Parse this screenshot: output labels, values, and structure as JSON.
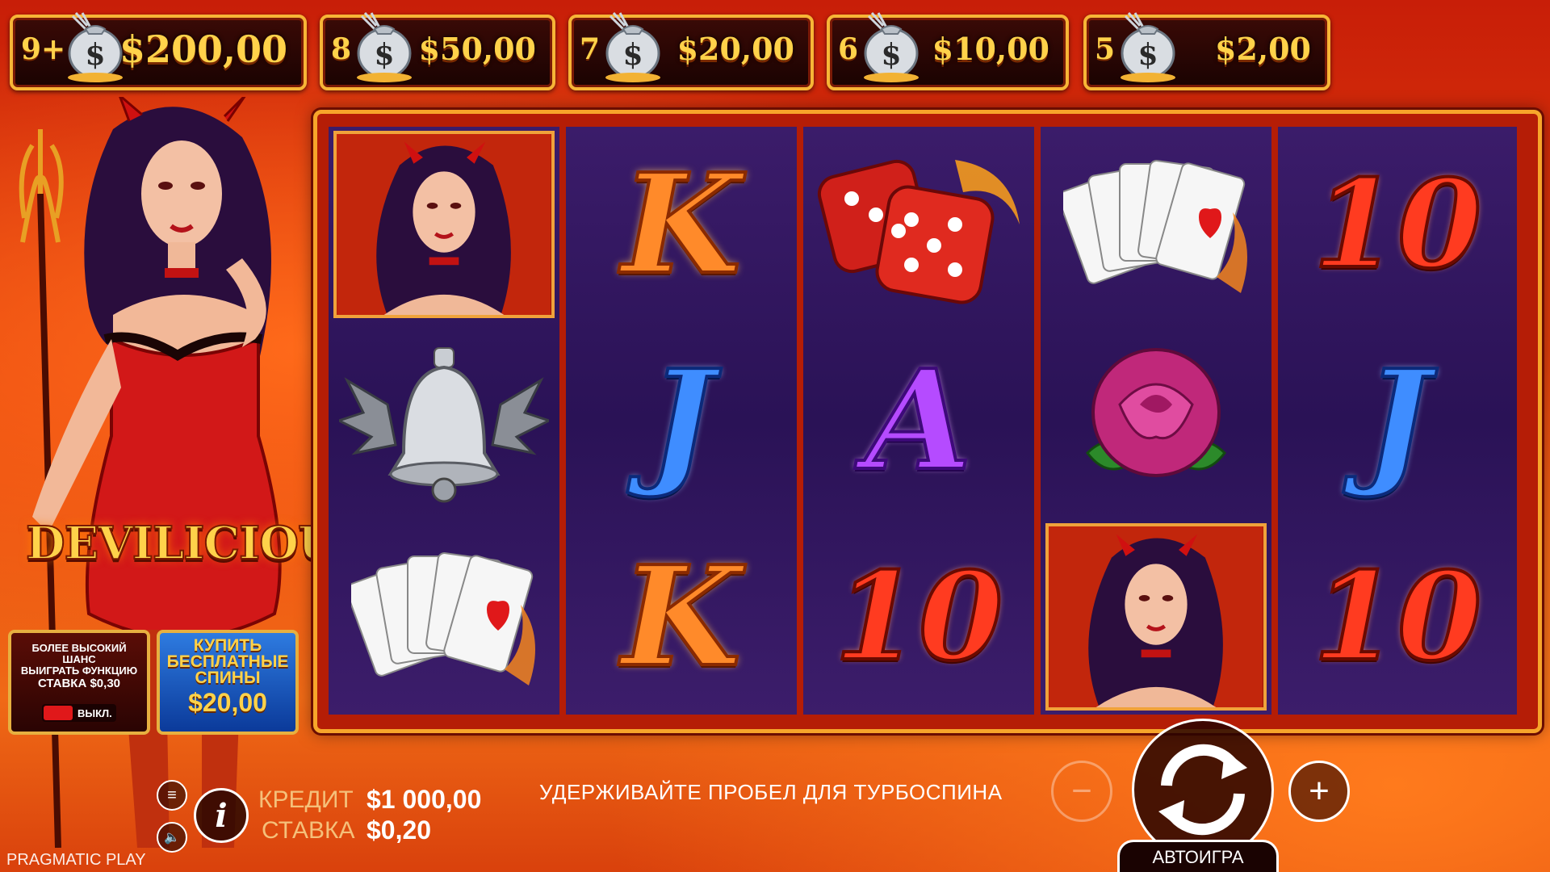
{
  "paytable": [
    {
      "count": "9+",
      "value": "$200,00"
    },
    {
      "count": "8",
      "value": "$50,00"
    },
    {
      "count": "7",
      "value": "$20,00"
    },
    {
      "count": "6",
      "value": "$10,00"
    },
    {
      "count": "5",
      "value": "$2,00"
    }
  ],
  "paytable_icon": "money-bag-with-trident-icon",
  "game_logo": "DEVILICIOUS",
  "reels": [
    [
      "devil-woman-symbol",
      "winged-bell-symbol",
      "playing-cards-symbol"
    ],
    [
      "K",
      "J",
      "K"
    ],
    [
      "dice-symbol",
      "A",
      "10"
    ],
    [
      "playing-cards-symbol",
      "rose-symbol",
      "devil-woman-symbol"
    ],
    [
      "10",
      "J",
      "10"
    ]
  ],
  "ante_bet": {
    "line1": "БОЛЕЕ ВЫСОКИЙ",
    "line2": "ШАНС",
    "line3": "ВЫИГРАТЬ ФУНКЦИЮ",
    "line4": "СТАВКА $0,30",
    "toggle_label": "ВЫКЛ."
  },
  "buy_feature": {
    "line1": "КУПИТЬ",
    "line2": "БЕСПЛАТНЫЕ",
    "line3": "СПИНЫ",
    "price": "$20,00"
  },
  "status": {
    "credit_label": "КРЕДИТ",
    "credit_value": "$1 000,00",
    "bet_label": "СТАВКА",
    "bet_value": "$0,20"
  },
  "hint": "УДЕРЖИВАЙТЕ ПРОБЕЛ ДЛЯ ТУРБОСПИНА",
  "autoplay_label": "АВТОИГРА",
  "brand": "PRAGMATIC PLAY",
  "colors": {
    "accent_gold": "#f7b536",
    "reel_purple": "#2a1256",
    "frame_red": "#b51d06"
  }
}
